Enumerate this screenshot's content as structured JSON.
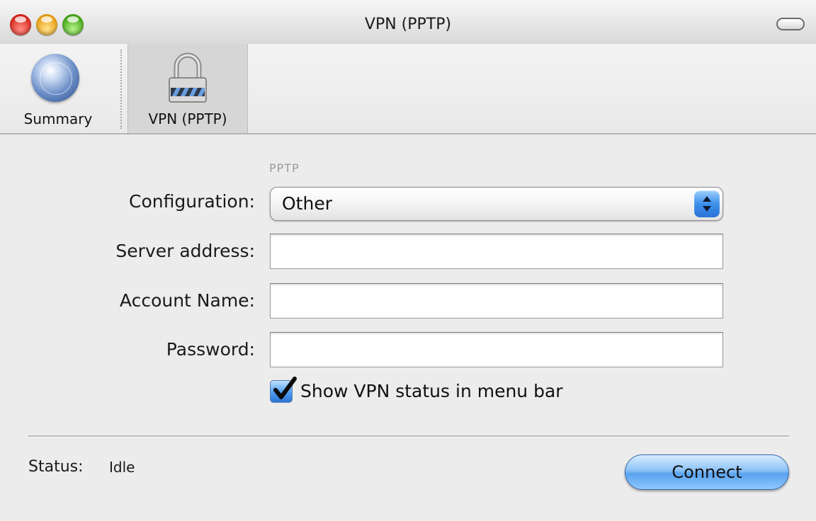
{
  "window": {
    "title": "VPN (PPTP)"
  },
  "toolbar": {
    "items": [
      {
        "label": "Summary",
        "icon": "globe-icon"
      },
      {
        "label": "VPN (PPTP)",
        "icon": "lock-icon",
        "selected": true
      }
    ]
  },
  "form": {
    "section_label": "PPTP",
    "configuration_label": "Configuration:",
    "configuration_value": "Other",
    "server_address_label": "Server address:",
    "server_address_value": "",
    "account_name_label": "Account Name:",
    "account_name_value": "",
    "password_label": "Password:",
    "password_value": "",
    "show_status_label": "Show VPN status in menu bar",
    "show_status_checked": true
  },
  "footer": {
    "status_label": "Status:",
    "status_value": "Idle",
    "connect_label": "Connect"
  },
  "colors": {
    "accent": "#3e91ea",
    "window_bg": "#ececec"
  }
}
